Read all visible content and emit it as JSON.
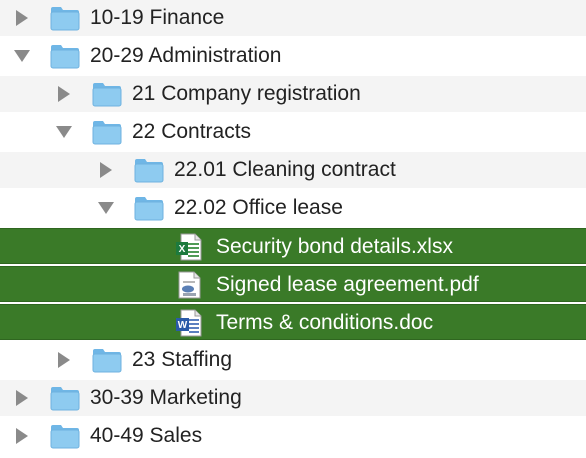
{
  "colors": {
    "selection": "#3a7a28",
    "folder": "#8ecbf0",
    "stripe": "#f4f4f4",
    "disclosure": "#8a8a8a"
  },
  "tree": {
    "items": [
      {
        "label": "10-19 Finance",
        "state": "collapsed",
        "icon": "folder-icon"
      },
      {
        "label": "20-29 Administration",
        "state": "expanded",
        "icon": "folder-icon"
      },
      {
        "label": "21 Company registration",
        "state": "collapsed",
        "icon": "folder-icon"
      },
      {
        "label": "22 Contracts",
        "state": "expanded",
        "icon": "folder-icon"
      },
      {
        "label": "22.01 Cleaning contract",
        "state": "collapsed",
        "icon": "folder-icon"
      },
      {
        "label": "22.02 Office lease",
        "state": "expanded",
        "icon": "folder-icon"
      },
      {
        "label": "Security bond details.xlsx",
        "state": "selected",
        "icon": "excel-file-icon"
      },
      {
        "label": "Signed lease agreement.pdf",
        "state": "selected",
        "icon": "pdf-file-icon"
      },
      {
        "label": "Terms & conditions.doc",
        "state": "selected",
        "icon": "word-file-icon"
      },
      {
        "label": "23 Staffing",
        "state": "collapsed",
        "icon": "folder-icon"
      },
      {
        "label": "30-39 Marketing",
        "state": "collapsed",
        "icon": "folder-icon"
      },
      {
        "label": "40-49 Sales",
        "state": "collapsed",
        "icon": "folder-icon"
      }
    ]
  }
}
